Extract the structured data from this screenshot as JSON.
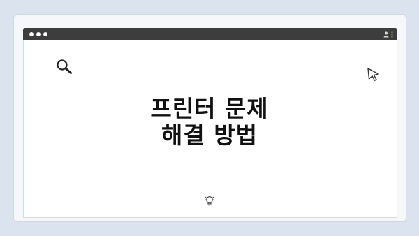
{
  "headline": {
    "line1": "프린터 문제",
    "line2": "해결 방법"
  },
  "icons": {
    "window_controls": "window-controls-dots",
    "profile": "person-icon",
    "menu": "kebab-menu-icon",
    "search": "search-icon",
    "cursor": "cursor-arrow-icon",
    "idea": "lightbulb-icon"
  },
  "colors": {
    "background": "#dbe4ee",
    "titlebar": "#3d3d3d",
    "canvas": "#ffffff",
    "text": "#111111"
  }
}
